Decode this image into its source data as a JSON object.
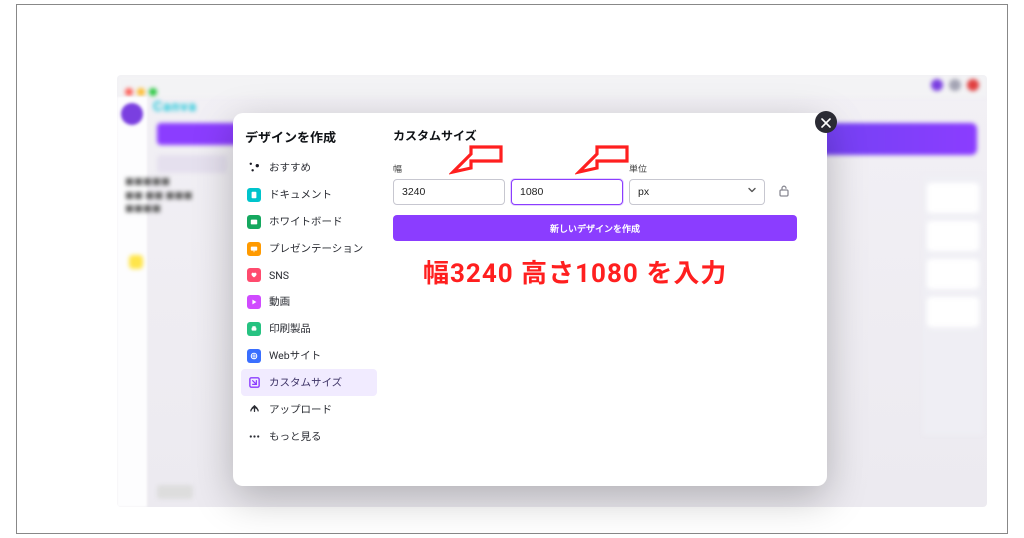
{
  "modal": {
    "title": "デザインを作成",
    "content_title": "カスタムサイズ",
    "sidebar": [
      {
        "icon": "sparkle-icon",
        "color": "#1a1a24",
        "label": "おすすめ"
      },
      {
        "icon": "document-icon",
        "color": "#00c4cc",
        "label": "ドキュメント"
      },
      {
        "icon": "whiteboard-icon",
        "color": "#15a85f",
        "label": "ホワイトボード"
      },
      {
        "icon": "presentation-icon",
        "color": "#ff9a00",
        "label": "プレゼンテーション"
      },
      {
        "icon": "sns-icon",
        "color": "#ff4b6e",
        "label": "SNS"
      },
      {
        "icon": "video-icon",
        "color": "#d04bff",
        "label": "動画"
      },
      {
        "icon": "print-icon",
        "color": "#26c281",
        "label": "印刷製品"
      },
      {
        "icon": "website-icon",
        "color": "#3a6fff",
        "label": "Webサイト"
      },
      {
        "icon": "customsize-icon",
        "color": "#8b3dff",
        "label": "カスタムサイズ",
        "selected": true
      },
      {
        "icon": "upload-icon",
        "color": "#2a2c33",
        "label": "アップロード"
      },
      {
        "icon": "more-icon",
        "color": "#2a2c33",
        "label": "もっと見る"
      }
    ],
    "fields": {
      "width_label": "幅",
      "width_value": "3240",
      "height_label": "",
      "height_value": "1080",
      "unit_label": "単位",
      "unit_value": "px"
    },
    "primary_button": "新しいデザインを作成"
  },
  "annotation": {
    "text": "幅3240 高さ1080 を入力"
  },
  "background": {
    "brand": "Canva"
  }
}
